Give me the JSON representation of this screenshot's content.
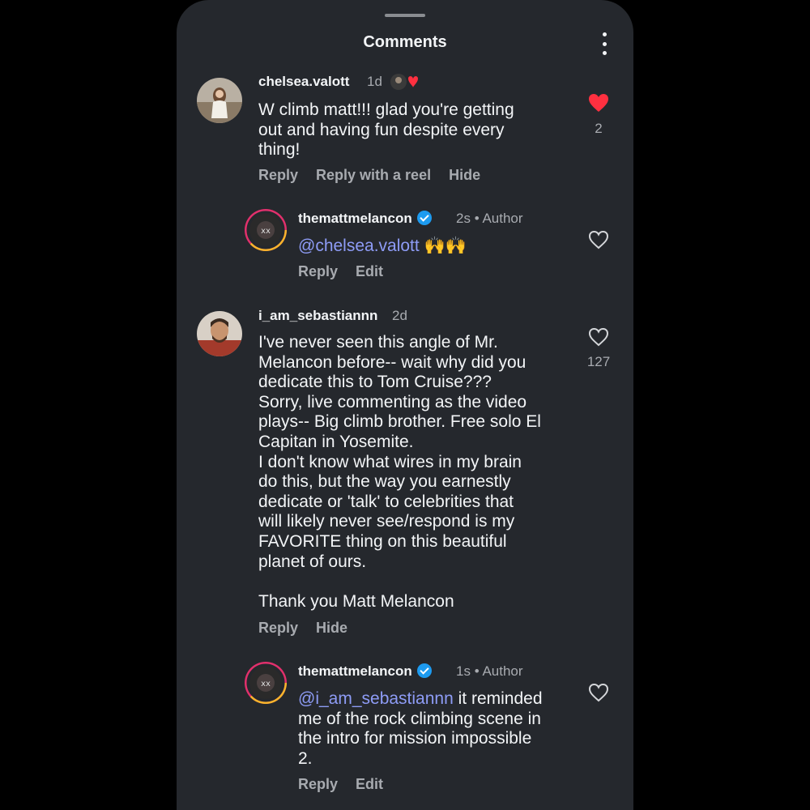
{
  "header": {
    "title": "Comments"
  },
  "comments": [
    {
      "username": "chelsea.valott",
      "time": "1d",
      "text": "W climb matt!!! glad you're getting\nout and having fun despite every\nthing!",
      "likes": "2",
      "liked": true,
      "actions": [
        "Reply",
        "Reply with a reel",
        "Hide"
      ]
    },
    {
      "username": "themattmelancon",
      "time": "2s",
      "author": "Author",
      "mention": "@chelsea.valott",
      "text": " 🙌🙌",
      "actions": [
        "Reply",
        "Edit"
      ]
    },
    {
      "username": "i_am_sebastiannn",
      "time": "2d",
      "text": "I've never seen this angle of Mr.\nMelancon before-- wait why did you\ndedicate this to Tom Cruise???\nSorry, live commenting as the video\nplays-- Big climb brother. Free solo El\nCapitan in Yosemite.\nI don't know what wires in my brain\ndo this, but the way you earnestly\ndedicate or 'talk' to celebrities that\nwill likely never see/respond is my\nFAVORITE thing on this beautiful\nplanet of ours.\n\nThank you Matt Melancon",
      "likes": "127",
      "liked": false,
      "actions": [
        "Reply",
        "Hide"
      ]
    },
    {
      "username": "themattmelancon",
      "time": "1s",
      "author": "Author",
      "mention": "@i_am_sebastiannn",
      "text": " it reminded\nme of the rock climbing scene in\nthe intro for mission impossible\n2.",
      "actions": [
        "Reply",
        "Edit"
      ]
    }
  ]
}
